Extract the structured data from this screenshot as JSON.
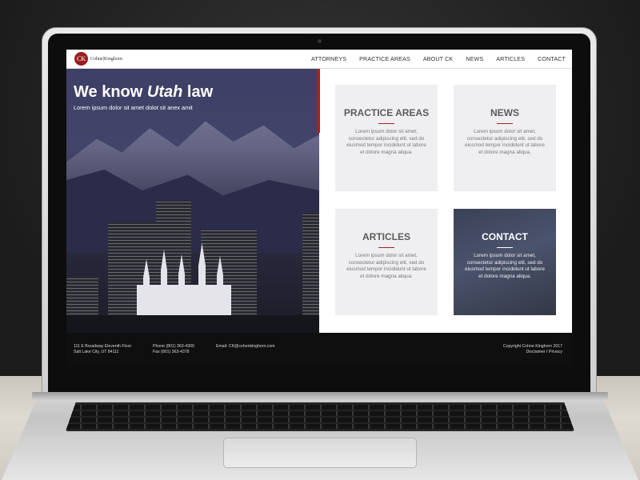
{
  "site": {
    "logo_initials": "CK",
    "logo_text": "Cohne|Kinghorn",
    "nav": [
      "ATTORNEYS",
      "PRACTICE AREAS",
      "ABOUT CK",
      "NEWS",
      "ARTICLES",
      "CONTACT"
    ],
    "hero": {
      "title_prefix": "We know ",
      "title_em": "Utah",
      "title_suffix": " law",
      "subtitle": "Lorem ipsum dolor sit amet dolot sit anex amit"
    },
    "cards": [
      {
        "title": "PRACTICE AREAS",
        "text": "Lorem ipsum dolor sit amet, consectetur adipiscing elit, sed do eiusmod tempor incididunt ut labore et dolore magna aliqua."
      },
      {
        "title": "NEWS",
        "text": "Lorem ipsum dolor sit amet, consectetur adipiscing elit, sed do eiusmod tempor incididunt ut labore et dolore magna aliqua."
      },
      {
        "title": "ARTICLES",
        "text": "Lorem ipsum dolor sit amet, consectetur adipiscing elit, sed do eiusmod tempor incididunt ut labore et dolore magna aliqua."
      },
      {
        "title": "CONTACT",
        "text": "Lorem ipsum dolor sit amet, consectetur adipiscing elit, sed do eiusmod tempor incididunt ut labore et dolore magna aliqua."
      }
    ],
    "footer": {
      "address_line1": "111 E Broadway Eleventh Floor",
      "address_line2": "Salt Lake City, UT 84111",
      "phone": "Phone (801) 363-4300",
      "fax": "Fax (801) 363-4378",
      "email": "Email: CK@cohenkinghorn.com",
      "copyright": "Copyright Cohne Kinghorn 2017",
      "links": "Disclaimer I Privacy"
    },
    "colors": {
      "accent": "#a42228",
      "dark": "#0f0f10",
      "card_bg": "#efeff1"
    }
  }
}
